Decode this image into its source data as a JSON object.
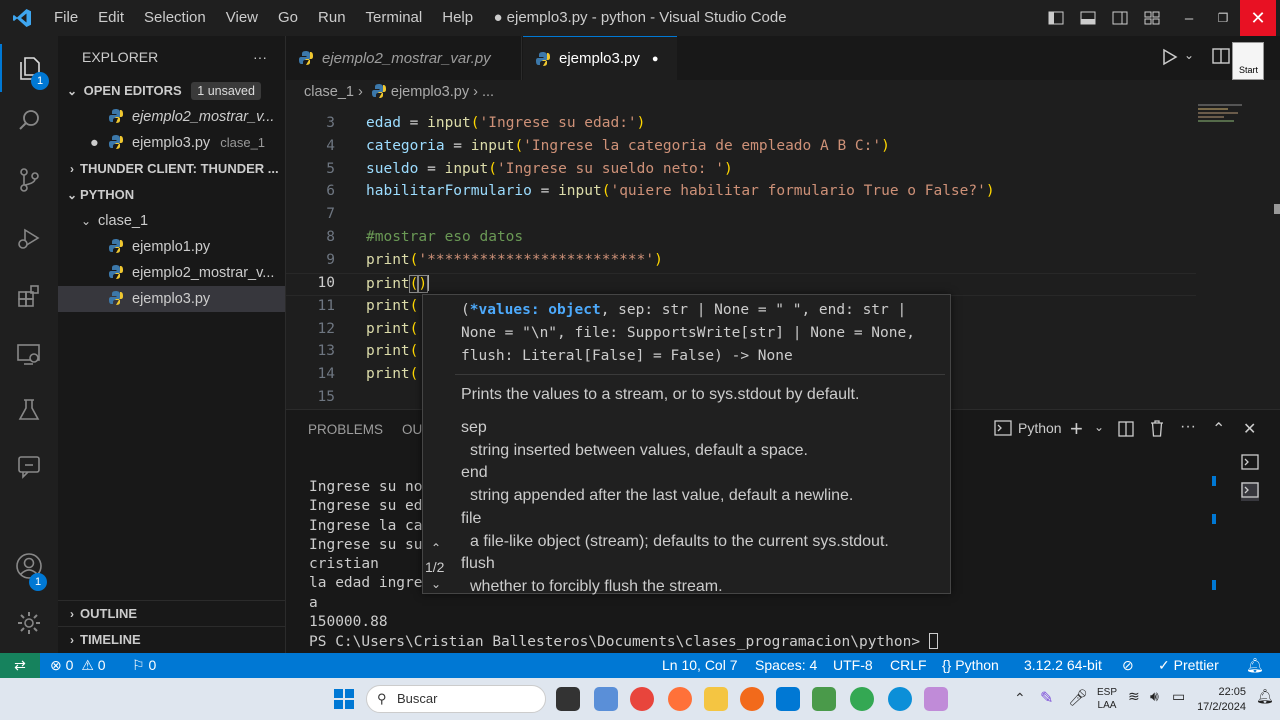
{
  "titlebar": {
    "menus": [
      "File",
      "Edit",
      "Selection",
      "View",
      "Go",
      "Run",
      "Terminal",
      "Help"
    ],
    "title": "● ejemplo3.py - python - Visual Studio Code"
  },
  "activity": {
    "explorer_badge": "1",
    "account_badge": "1"
  },
  "sidebar": {
    "header": "EXPLORER",
    "more": "···",
    "open_editors": {
      "label": "OPEN EDITORS",
      "badge": "1 unsaved",
      "items": [
        {
          "name": "ejemplo2_mostrar_v...",
          "folder": ""
        },
        {
          "name": "ejemplo3.py",
          "folder": "clase_1"
        }
      ]
    },
    "thunder": "THUNDER CLIENT: THUNDER ...",
    "python": {
      "label": "PYTHON",
      "folder": "clase_1",
      "files": [
        "ejemplo1.py",
        "ejemplo2_mostrar_v...",
        "ejemplo3.py"
      ]
    },
    "outline": "OUTLINE",
    "timeline": "TIMELINE"
  },
  "tabs": [
    {
      "label": "ejemplo2_mostrar_var.py"
    },
    {
      "label": "ejemplo3.py"
    }
  ],
  "breadcrumbs": {
    "folder": "clase_1",
    "sep": "›",
    "file": "ejemplo3.py",
    "tail": "› ..."
  },
  "editor": {
    "line_numbers": [
      "3",
      "4",
      "5",
      "6",
      "7",
      "8",
      "9",
      "10",
      "11",
      "12",
      "13",
      "14",
      "15"
    ],
    "lines": [
      {
        "a": "edad",
        "b": "input",
        "c": "'Ingrese su edad:'"
      },
      {
        "a": "categoria",
        "b": "input",
        "c": "'Ingrese la categoria de empleado A B C:'"
      },
      {
        "a": "sueldo",
        "b": "input",
        "c": "'Ingrese su sueldo neto: '"
      },
      {
        "a": "habilitarFormulario",
        "b": "input",
        "c": "'quiere habilitar formulario True o False?'"
      },
      {
        "comment": "#mostrar eso datos"
      },
      {
        "fn": "print",
        "str": "'*************************'"
      },
      {
        "fn": "print"
      },
      {
        "fn": "print"
      },
      {
        "fn": "print"
      },
      {
        "fn": "print"
      },
      {
        "fn": "print"
      }
    ]
  },
  "hover": {
    "sig1": "(*values: object, sep: str | None = \" \", end: str |",
    "sig2": "None = \"\\n\", file: SupportsWrite[str] | None = None,",
    "sig3": "flush: Literal[False] = False) -> None",
    "desc": "Prints the values to a stream, or to sys.stdout by default.",
    "params": [
      {
        "name": "sep",
        "desc": "string inserted between values, default a space."
      },
      {
        "name": "end",
        "desc": "string appended after the last value, default a newline."
      },
      {
        "name": "file",
        "desc": "a file-like object (stream); defaults to the current sys.stdout."
      },
      {
        "name": "flush",
        "desc": "whether to forcibly flush the stream."
      }
    ],
    "counter": "1/2"
  },
  "panel": {
    "tabs": [
      "PROBLEMS",
      "OU"
    ],
    "terminal_name": "Python",
    "lines": [
      "Ingrese su no",
      "Ingrese su ed",
      "Ingrese la ca",
      "Ingrese su su",
      "cristian",
      "la edad ingre",
      "a",
      "150000.88"
    ],
    "prompt": "PS C:\\Users\\Cristian Ballesteros\\Documents\\clases_programacion\\python> "
  },
  "status": {
    "remote": "⇄",
    "errors": "0",
    "warnings": "0",
    "ports": "0",
    "position": "Ln 10, Col 7",
    "spaces": "Spaces: 4",
    "encoding": "UTF-8",
    "eol": "CRLF",
    "language": "Python",
    "interpreter": "3.12.2 64-bit",
    "prettier": "Prettier"
  },
  "taskbar": {
    "search": "Buscar",
    "lang1": "ESP",
    "lang2": "LAA",
    "time": "22:05",
    "date": "17/2/2024"
  },
  "colors": {
    "accent": "#0078d4",
    "close": "#e81123"
  }
}
